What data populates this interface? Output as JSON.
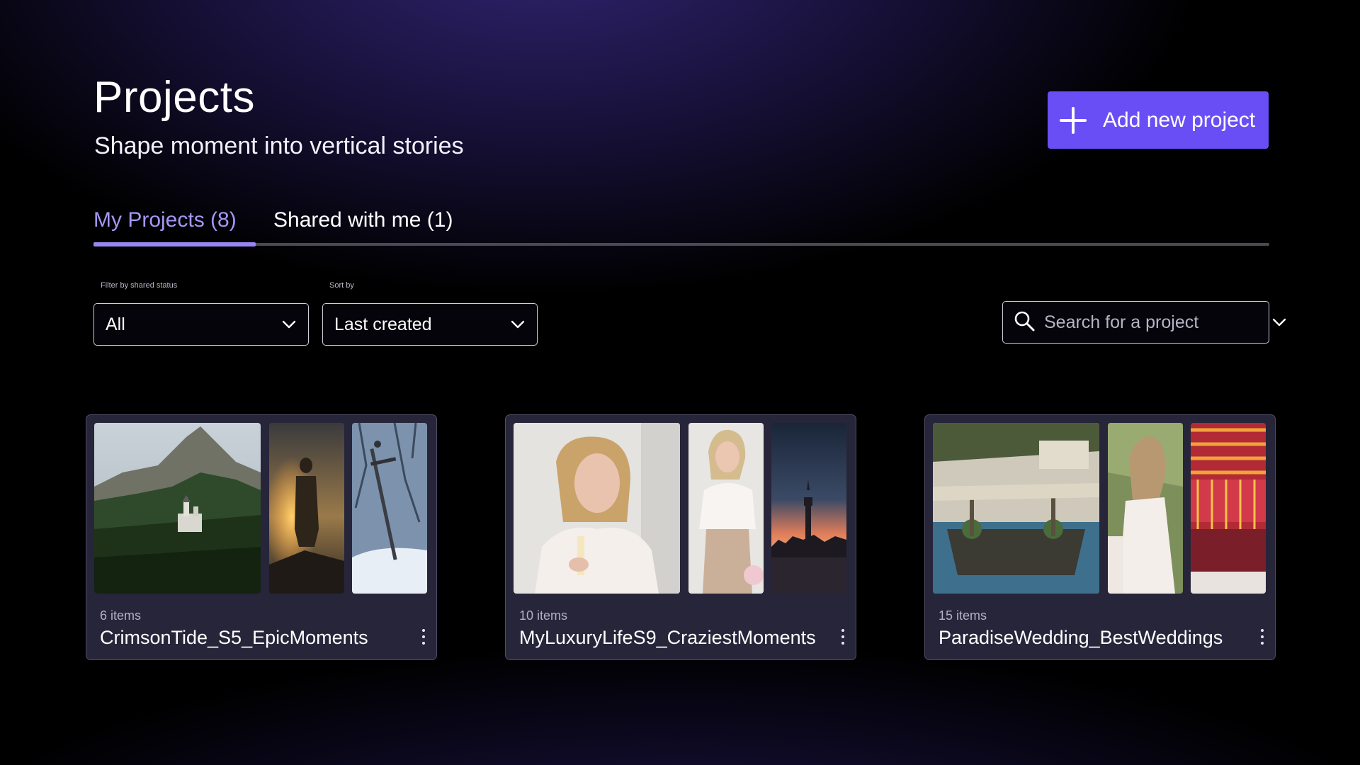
{
  "header": {
    "title": "Projects",
    "subtitle": "Shape moment into vertical stories",
    "add_button_label": "Add new project"
  },
  "tabs": [
    {
      "label": "My Projects (8)",
      "active": true
    },
    {
      "label": "Shared with me (1)",
      "active": false
    }
  ],
  "filters": {
    "shared_status": {
      "label": "Filter by shared status",
      "value": "All"
    },
    "sort": {
      "label": "Sort by",
      "value": "Last created"
    },
    "search": {
      "placeholder": "Search for a project"
    }
  },
  "projects": [
    {
      "count": "6 items",
      "name": "CrimsonTide_S5_EpicMoments",
      "thumbnails": [
        "castle-mountain-forest",
        "warrior-sunset-silhouette",
        "sword-in-snow"
      ]
    },
    {
      "count": "10 items",
      "name": "MyLuxuryLifeS9_CraziestMoments",
      "thumbnails": [
        "woman-champagne-portrait",
        "woman-blouse-standing",
        "city-skyline-dusk"
      ]
    },
    {
      "count": "15 items",
      "name": "ParadiseWedding_BestWeddings",
      "thumbnails": [
        "wedding-pool-venue",
        "bride-in-dress",
        "colorful-mandap-decor"
      ]
    }
  ],
  "colors": {
    "accent": "#6a4ef5",
    "tab_active": "#a596f5",
    "card_bg": "#27253a"
  }
}
